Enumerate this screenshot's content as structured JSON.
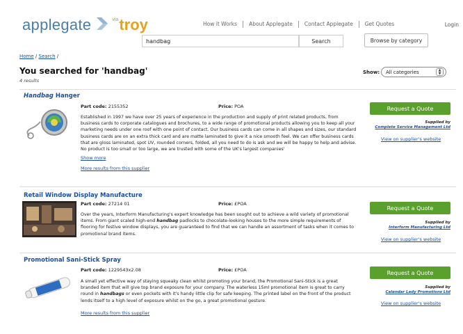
{
  "header": {
    "logo_text_1": "applegate",
    "logo_via": "via",
    "logo_text_2": "troy",
    "nav": [
      "How it Works",
      "About Applegate",
      "Contact Applegate",
      "Get Quotes"
    ],
    "login_label": "Login"
  },
  "search": {
    "value": "handbag",
    "button_label": "Search",
    "browse_label": "Browse by category"
  },
  "breadcrumb": {
    "home": "Home",
    "search": "Search",
    "sep": "/"
  },
  "results": {
    "heading": "You searched for 'handbag'",
    "count": "4 results",
    "show_label": "Show:",
    "show_value": "All categories"
  },
  "labels": {
    "part_code": "Part code:",
    "price": "Price:",
    "request_quote": "Request a Quote",
    "supplied_by": "Supplied by",
    "view_website": "View on supplier's website",
    "show_more": "Show more",
    "more_results": "More results from this supplier"
  },
  "items": [
    {
      "title_hl": "Handbag",
      "title_rest": " Hanger",
      "part_code": "2155352",
      "price": "POA",
      "desc": "Established in 1997 we have over 25 years of experience in the production and supply of print related products, from business cards to corporate catalogues and brochures, to a wide range of promotional products allowing you to keep all your marketing needs under one roof with one point of contact. Our business cards can come in all shapes and sizes, our standard business cards are on an extra thick card and are matte laminated to give it a nice smooth feel. We can offer business cards that are gloss laminated, spot UV, rounded corners, folded, all you need to do is ask and we will be happy to help and advise. No product is too small or too large, we are trusted with some of the UK's largest companies'",
      "supplier": "Complete Service Management Ltd"
    },
    {
      "title": "Retail Window Display Manufacture",
      "part_code": "27214 01",
      "price": "£POA",
      "desc_1": "Over the years, Interform Manufacturing's expert knowledge has been sought out to achieve a wild variety of promotional items. From giant scaled high-end ",
      "desc_hl": "handbag",
      "desc_2": " padlocks to chocolate-looking houses to the more simple requirements of flooring for festive window displays, you are guaranteed to find that we can handle an assortment of tasks when it comes to promotional brand items.",
      "supplier": "Interform Manufacturing Ltd"
    },
    {
      "title": "Promotional Sani-Stick Spray",
      "part_code": "1229543x2.08",
      "price": "£POA",
      "desc_1": "A small yet effective way of staying squeaky clean whilst promoting your brand, the Promotional Sani-Stick is a great branded item that will give top brand exposure for your company. The waterless 15ml promotional item is great to carry round in ",
      "desc_hl": "handbags",
      "desc_2": " or even pockets with it's handy little clip for safe keeping. The printed label on the front of the product lends itself to a high level of exposure whilst on the go, a great promotional gesture.",
      "supplier": "Calendar Lady Promotions Ltd"
    }
  ],
  "colors": {
    "link": "#1a4fa0",
    "quote_button": "#5aa02c",
    "logo_blue": "#4a7ea8",
    "logo_orange": "#e5a21c"
  }
}
